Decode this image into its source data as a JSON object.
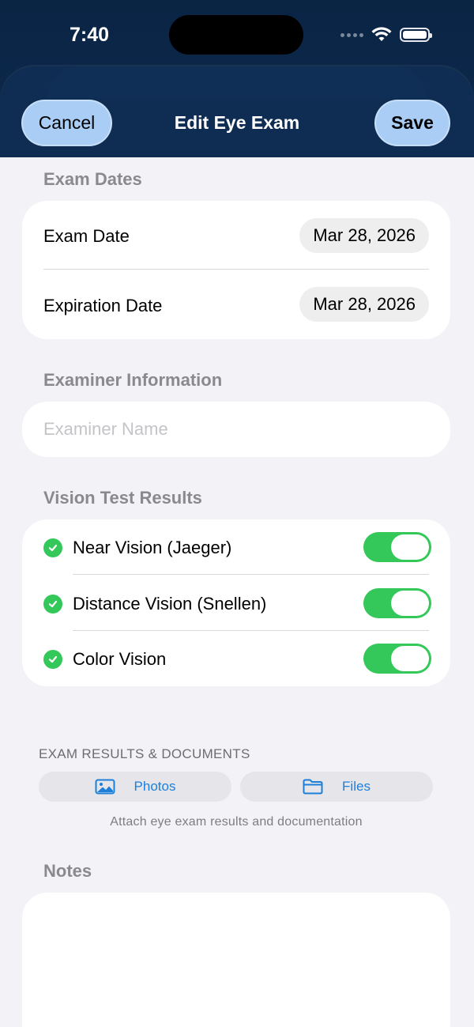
{
  "status_bar": {
    "time": "7:40"
  },
  "nav": {
    "cancel_label": "Cancel",
    "title": "Edit Eye Exam",
    "save_label": "Save"
  },
  "exam_dates": {
    "title": "Exam Dates",
    "rows": [
      {
        "label": "Exam Date",
        "value": "Mar 28, 2026"
      },
      {
        "label": "Expiration Date",
        "value": "Mar 28, 2026"
      }
    ]
  },
  "examiner": {
    "title": "Examiner Information",
    "placeholder": "Examiner Name"
  },
  "vision_tests": {
    "title": "Vision Test Results",
    "items": [
      {
        "label": "Near Vision (Jaeger)",
        "on": true
      },
      {
        "label": "Distance Vision (Snellen)",
        "on": true
      },
      {
        "label": "Color Vision",
        "on": true
      }
    ]
  },
  "documents": {
    "caption": "EXAM RESULTS & DOCUMENTS",
    "photos_label": "Photos",
    "files_label": "Files",
    "hint": "Attach eye exam results and documentation"
  },
  "notes": {
    "title": "Notes"
  },
  "colors": {
    "accent": "#1e7fd9",
    "toggle_on": "#34c759",
    "header": "#0d2a4d",
    "nav_button": "#a9cdf5"
  }
}
